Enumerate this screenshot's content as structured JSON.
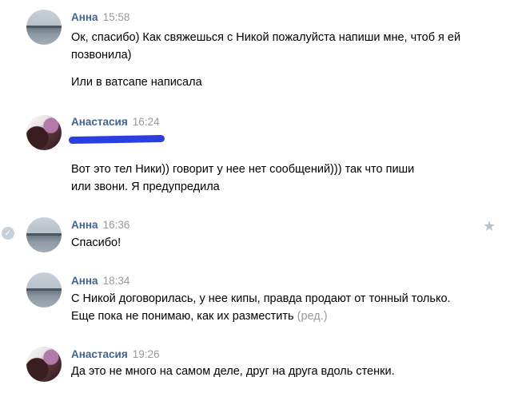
{
  "messages": [
    {
      "author": "Анна",
      "time": "15:58",
      "avatar": "lake-photo",
      "lines": [
        "Ок, спасибо) Как свяжешься с Никой пожалуйста напиши мне, чтоб я ей позвонила)",
        "Или в ватсапе написала"
      ]
    },
    {
      "author": "Анастасия",
      "time": "16:24",
      "avatar": "person-photo",
      "lines": [
        "Вот это тел Ники)) говорит у нее нет сообщений))) так что пиши или звони. Я предупредила"
      ]
    },
    {
      "author": "Анна",
      "time": "16:36",
      "avatar": "lake-photo",
      "lines": [
        "Спасибо!"
      ],
      "status_icon": "check-circle-icon",
      "action_icon": "star-icon",
      "check_glyph": "✓",
      "star_glyph": "★"
    },
    {
      "author": "Анна",
      "time": "18:34",
      "avatar": "lake-photo",
      "lines": [
        "С Никой договорилась, у нее кипы, правда продают от тонный только. Еще пока не понимаю, как их разместить"
      ],
      "edited_label": "(ред.)"
    },
    {
      "author": "Анастасия",
      "time": "19:26",
      "avatar": "person-photo",
      "lines": [
        "Да это не много на самом деле, друг на друга вдоль стенки."
      ]
    }
  ],
  "colors": {
    "author": "#42648b",
    "time": "#999999",
    "text": "#000000",
    "redaction_scribble": "#2b3ee0"
  }
}
